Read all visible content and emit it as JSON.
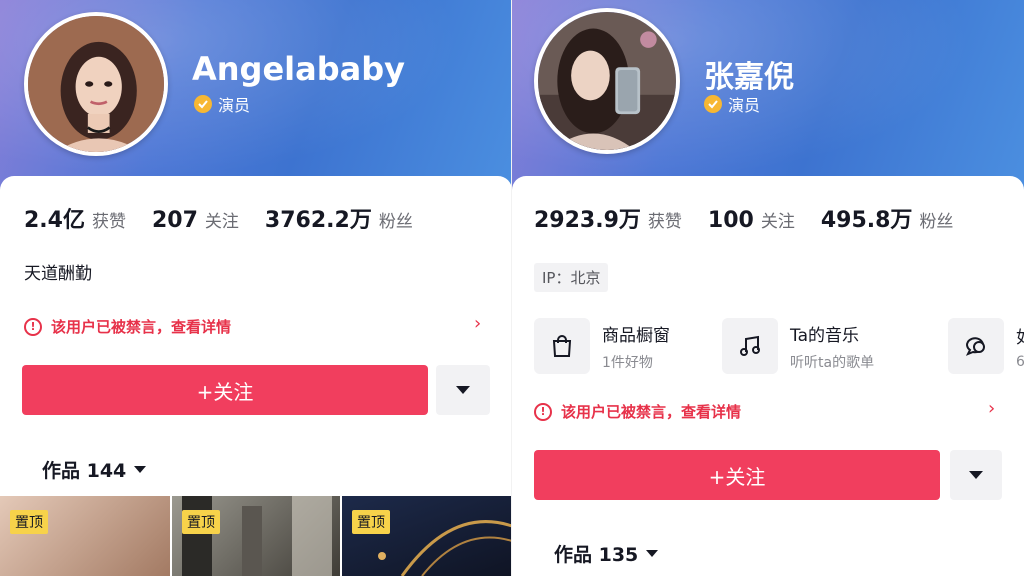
{
  "left": {
    "name": "Angelababy",
    "verified_label": "演员",
    "stats": [
      {
        "num": "2.4亿",
        "label": "获赞"
      },
      {
        "num": "207",
        "label": "关注"
      },
      {
        "num": "3762.2万",
        "label": "粉丝"
      }
    ],
    "bio": "天道酬勤",
    "warning": "该用户已被禁言，查看详情",
    "chevron": "›",
    "follow_label": "+关注",
    "works_label": "作品 144",
    "pinned_label": "置顶"
  },
  "right": {
    "name": "张嘉倪",
    "verified_label": "演员",
    "stats": [
      {
        "num": "2923.9万",
        "label": "获赞"
      },
      {
        "num": "100",
        "label": "关注"
      },
      {
        "num": "495.8万",
        "label": "粉丝"
      }
    ],
    "ip": "IP：北京",
    "shop_items": [
      {
        "title": "商品橱窗",
        "subtitle": "1件好物",
        "icon": "shopping-bag-icon"
      },
      {
        "title": "Ta的音乐",
        "subtitle": "听听ta的歌单",
        "icon": "music-note-icon"
      },
      {
        "title": "如",
        "subtitle": "6",
        "icon": "chat-bubble-icon"
      }
    ],
    "warning": "该用户已被禁言，查看详情",
    "chevron": "›",
    "follow_label": "+关注",
    "works_label": "作品 135"
  },
  "colors": {
    "accent": "#f13e5e",
    "warning": "#e7324a",
    "header_blue": "#3d73d0",
    "verified_gold": "#f7b733",
    "pin_yellow": "#f7d24a"
  }
}
